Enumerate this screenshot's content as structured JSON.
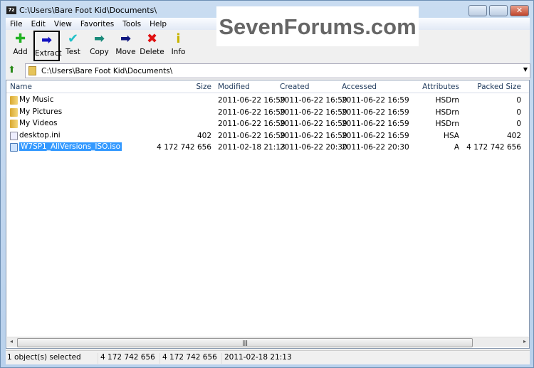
{
  "window": {
    "title": "C:\\Users\\Bare Foot Kid\\Documents\\",
    "app_icon": "7z"
  },
  "menu": [
    "File",
    "Edit",
    "View",
    "Favorites",
    "Tools",
    "Help"
  ],
  "toolbar": [
    {
      "label": "Add",
      "icon": "plus-icon",
      "color": "#22b222",
      "glyph": "✚"
    },
    {
      "label": "Extract",
      "icon": "extract-arrow-icon",
      "color": "#1010c0",
      "glyph": "➡"
    },
    {
      "label": "Test",
      "icon": "test-check-icon",
      "color": "#20c0c8",
      "glyph": "✔"
    },
    {
      "label": "Copy",
      "icon": "copy-arrow-icon",
      "color": "#1a8a7a",
      "glyph": "➡"
    },
    {
      "label": "Move",
      "icon": "move-arrow-icon",
      "color": "#101880",
      "glyph": "➡"
    },
    {
      "label": "Delete",
      "icon": "delete-x-icon",
      "color": "#e01010",
      "glyph": "✖"
    },
    {
      "label": "Info",
      "icon": "info-icon",
      "color": "#c8b400",
      "glyph": "i"
    }
  ],
  "address": "C:\\Users\\Bare Foot Kid\\Documents\\",
  "columns": [
    "Name",
    "Size",
    "Modified",
    "Created",
    "Accessed",
    "Attributes",
    "Packed Size"
  ],
  "rows": [
    {
      "type": "folder",
      "name": "My Music",
      "size": "",
      "modified": "2011-06-22 16:59",
      "created": "2011-06-22 16:59",
      "accessed": "2011-06-22 16:59",
      "attributes": "HSDrn",
      "packed": "0"
    },
    {
      "type": "folder",
      "name": "My Pictures",
      "size": "",
      "modified": "2011-06-22 16:59",
      "created": "2011-06-22 16:59",
      "accessed": "2011-06-22 16:59",
      "attributes": "HSDrn",
      "packed": "0"
    },
    {
      "type": "folder",
      "name": "My Videos",
      "size": "",
      "modified": "2011-06-22 16:59",
      "created": "2011-06-22 16:59",
      "accessed": "2011-06-22 16:59",
      "attributes": "HSDrn",
      "packed": "0"
    },
    {
      "type": "ini",
      "name": "desktop.ini",
      "size": "402",
      "modified": "2011-06-22 16:59",
      "created": "2011-06-22 16:59",
      "accessed": "2011-06-22 16:59",
      "attributes": "HSA",
      "packed": "402"
    },
    {
      "type": "iso",
      "name": "W7SP1_AllVersions_ISO.iso",
      "size": "4 172 742 656",
      "modified": "2011-02-18 21:13",
      "created": "2011-06-22 20:30",
      "accessed": "2011-06-22 20:30",
      "attributes": "A",
      "packed": "4 172 742 656",
      "selected": true
    }
  ],
  "status": [
    "1 object(s) selected",
    "4 172 742 656",
    "4 172 742 656",
    "2011-02-18 21:13"
  ],
  "watermark": "SevenForums.com"
}
